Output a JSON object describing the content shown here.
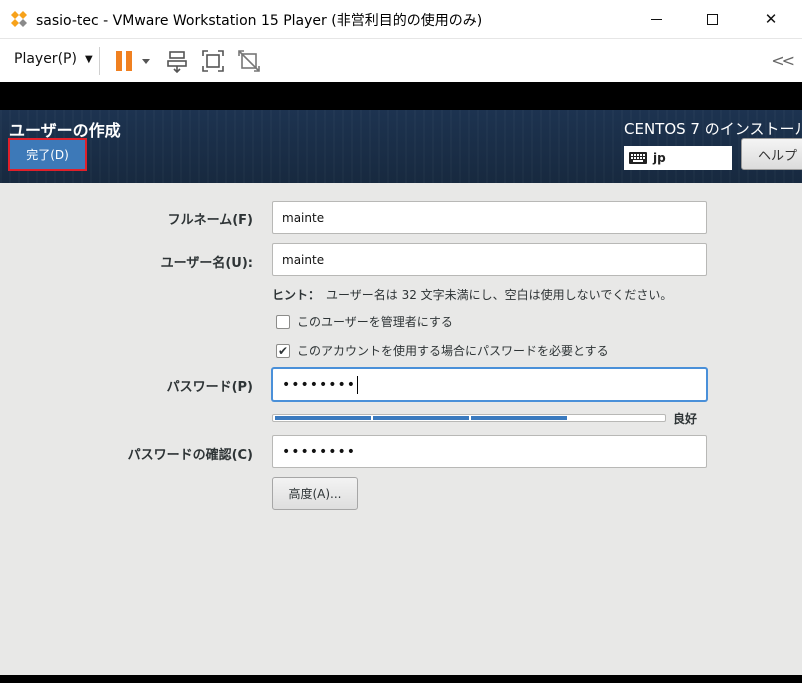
{
  "window": {
    "title": "sasio-tec - VMware Workstation 15 Player (非営利目的の使用のみ)",
    "minimize": "—",
    "maximize": "☐",
    "close": "✕"
  },
  "toolbar": {
    "player_menu": "Player(P)",
    "player_menu_arrow": "▼",
    "collapse": "<<",
    "accent_color": "#f08020"
  },
  "header": {
    "screen_title": "ユーザーの作成",
    "done_button": "完了(D)",
    "product_title": "CENTOS 7 のインストール",
    "keyboard_layout": "jp",
    "help_button": "ヘルプ"
  },
  "form": {
    "fullname_label": "フルネーム(F)",
    "fullname_value": "mainte",
    "username_label": "ユーザー名(U):",
    "username_value": "mainte",
    "hint_title": "ヒント：",
    "hint_text": "ユーザー名は 32 文字未満にし、空白は使用しないでください。",
    "admin_checkbox_label": "このユーザーを管理者にする",
    "admin_checked": false,
    "require_password_label": "このアカウントを使用する場合にパスワードを必要とする",
    "require_password_checked": true,
    "password_label": "パスワード(P)",
    "password_value": "••••••••",
    "strength_label": "良好",
    "strength_fraction": 0.75,
    "confirm_label": "パスワードの確認(C)",
    "confirm_value": "••••••••",
    "advanced_button": "高度(A)..."
  }
}
